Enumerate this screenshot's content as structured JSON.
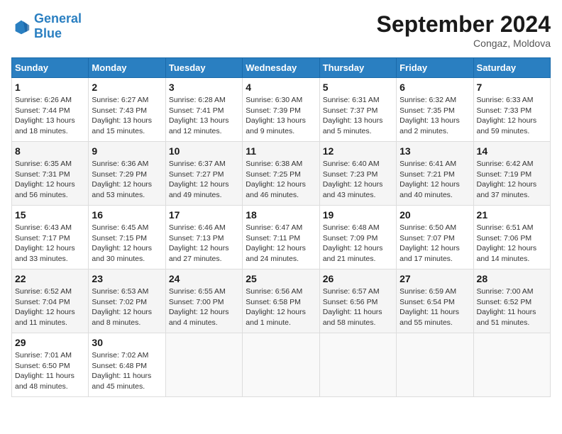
{
  "header": {
    "logo_general": "General",
    "logo_blue": "Blue",
    "month_title": "September 2024",
    "location": "Congaz, Moldova"
  },
  "columns": [
    "Sunday",
    "Monday",
    "Tuesday",
    "Wednesday",
    "Thursday",
    "Friday",
    "Saturday"
  ],
  "weeks": [
    [
      {
        "day": "1",
        "info": "Sunrise: 6:26 AM\nSunset: 7:44 PM\nDaylight: 13 hours and 18 minutes."
      },
      {
        "day": "2",
        "info": "Sunrise: 6:27 AM\nSunset: 7:43 PM\nDaylight: 13 hours and 15 minutes."
      },
      {
        "day": "3",
        "info": "Sunrise: 6:28 AM\nSunset: 7:41 PM\nDaylight: 13 hours and 12 minutes."
      },
      {
        "day": "4",
        "info": "Sunrise: 6:30 AM\nSunset: 7:39 PM\nDaylight: 13 hours and 9 minutes."
      },
      {
        "day": "5",
        "info": "Sunrise: 6:31 AM\nSunset: 7:37 PM\nDaylight: 13 hours and 5 minutes."
      },
      {
        "day": "6",
        "info": "Sunrise: 6:32 AM\nSunset: 7:35 PM\nDaylight: 13 hours and 2 minutes."
      },
      {
        "day": "7",
        "info": "Sunrise: 6:33 AM\nSunset: 7:33 PM\nDaylight: 12 hours and 59 minutes."
      }
    ],
    [
      {
        "day": "8",
        "info": "Sunrise: 6:35 AM\nSunset: 7:31 PM\nDaylight: 12 hours and 56 minutes."
      },
      {
        "day": "9",
        "info": "Sunrise: 6:36 AM\nSunset: 7:29 PM\nDaylight: 12 hours and 53 minutes."
      },
      {
        "day": "10",
        "info": "Sunrise: 6:37 AM\nSunset: 7:27 PM\nDaylight: 12 hours and 49 minutes."
      },
      {
        "day": "11",
        "info": "Sunrise: 6:38 AM\nSunset: 7:25 PM\nDaylight: 12 hours and 46 minutes."
      },
      {
        "day": "12",
        "info": "Sunrise: 6:40 AM\nSunset: 7:23 PM\nDaylight: 12 hours and 43 minutes."
      },
      {
        "day": "13",
        "info": "Sunrise: 6:41 AM\nSunset: 7:21 PM\nDaylight: 12 hours and 40 minutes."
      },
      {
        "day": "14",
        "info": "Sunrise: 6:42 AM\nSunset: 7:19 PM\nDaylight: 12 hours and 37 minutes."
      }
    ],
    [
      {
        "day": "15",
        "info": "Sunrise: 6:43 AM\nSunset: 7:17 PM\nDaylight: 12 hours and 33 minutes."
      },
      {
        "day": "16",
        "info": "Sunrise: 6:45 AM\nSunset: 7:15 PM\nDaylight: 12 hours and 30 minutes."
      },
      {
        "day": "17",
        "info": "Sunrise: 6:46 AM\nSunset: 7:13 PM\nDaylight: 12 hours and 27 minutes."
      },
      {
        "day": "18",
        "info": "Sunrise: 6:47 AM\nSunset: 7:11 PM\nDaylight: 12 hours and 24 minutes."
      },
      {
        "day": "19",
        "info": "Sunrise: 6:48 AM\nSunset: 7:09 PM\nDaylight: 12 hours and 21 minutes."
      },
      {
        "day": "20",
        "info": "Sunrise: 6:50 AM\nSunset: 7:07 PM\nDaylight: 12 hours and 17 minutes."
      },
      {
        "day": "21",
        "info": "Sunrise: 6:51 AM\nSunset: 7:06 PM\nDaylight: 12 hours and 14 minutes."
      }
    ],
    [
      {
        "day": "22",
        "info": "Sunrise: 6:52 AM\nSunset: 7:04 PM\nDaylight: 12 hours and 11 minutes."
      },
      {
        "day": "23",
        "info": "Sunrise: 6:53 AM\nSunset: 7:02 PM\nDaylight: 12 hours and 8 minutes."
      },
      {
        "day": "24",
        "info": "Sunrise: 6:55 AM\nSunset: 7:00 PM\nDaylight: 12 hours and 4 minutes."
      },
      {
        "day": "25",
        "info": "Sunrise: 6:56 AM\nSunset: 6:58 PM\nDaylight: 12 hours and 1 minute."
      },
      {
        "day": "26",
        "info": "Sunrise: 6:57 AM\nSunset: 6:56 PM\nDaylight: 11 hours and 58 minutes."
      },
      {
        "day": "27",
        "info": "Sunrise: 6:59 AM\nSunset: 6:54 PM\nDaylight: 11 hours and 55 minutes."
      },
      {
        "day": "28",
        "info": "Sunrise: 7:00 AM\nSunset: 6:52 PM\nDaylight: 11 hours and 51 minutes."
      }
    ],
    [
      {
        "day": "29",
        "info": "Sunrise: 7:01 AM\nSunset: 6:50 PM\nDaylight: 11 hours and 48 minutes."
      },
      {
        "day": "30",
        "info": "Sunrise: 7:02 AM\nSunset: 6:48 PM\nDaylight: 11 hours and 45 minutes."
      },
      null,
      null,
      null,
      null,
      null
    ]
  ]
}
